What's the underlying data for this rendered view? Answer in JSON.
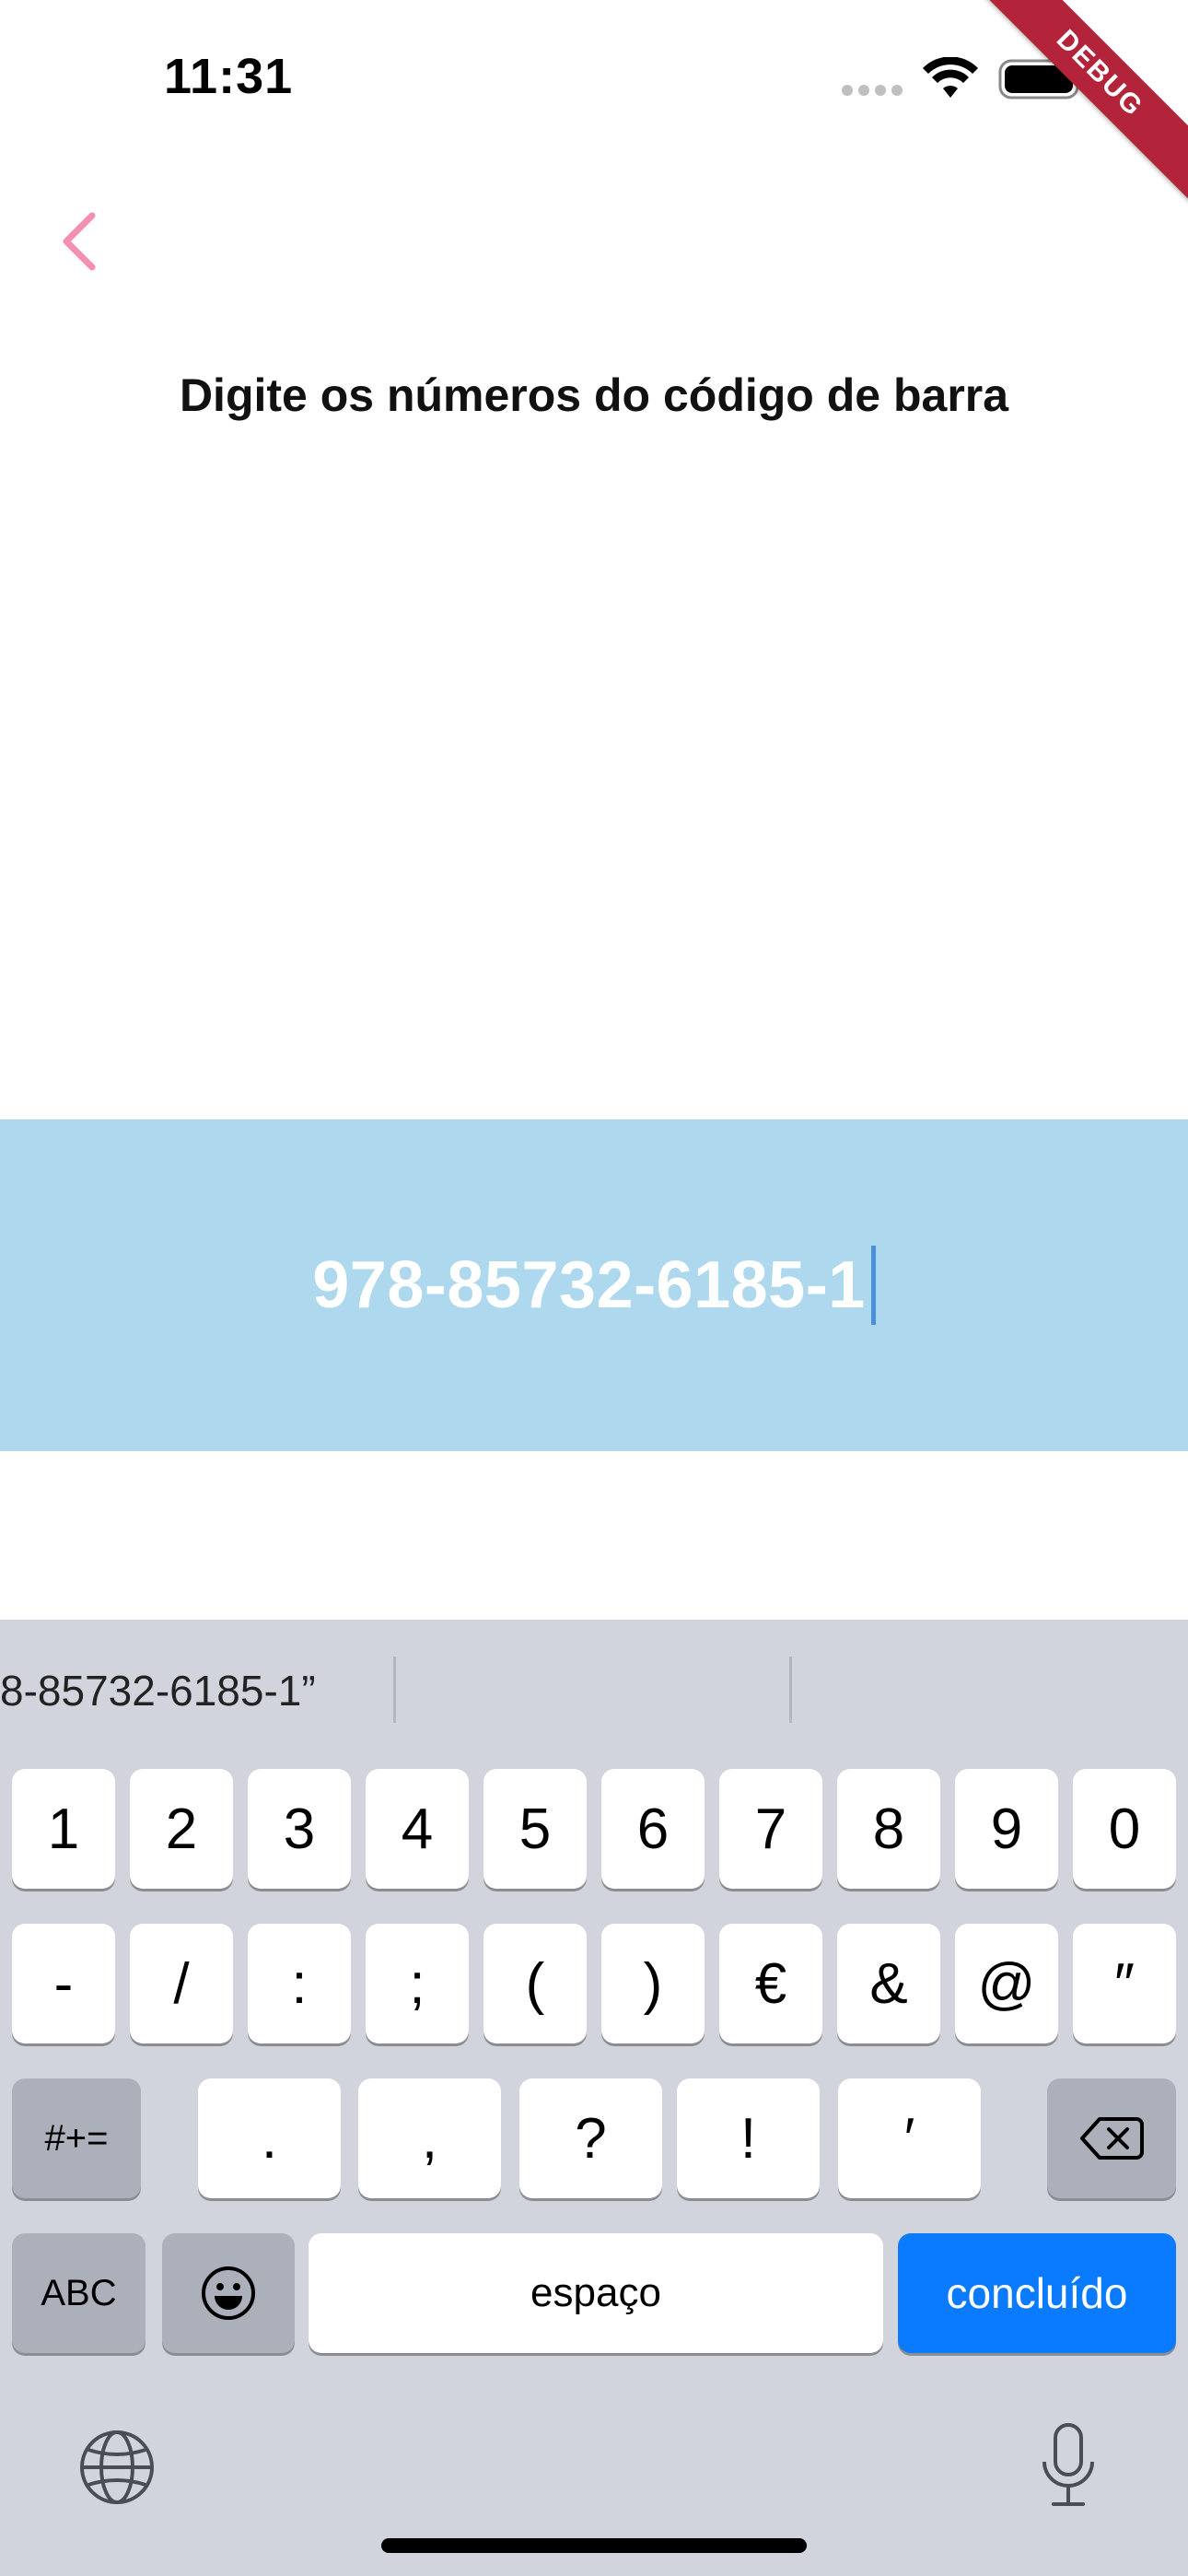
{
  "status_bar": {
    "time": "11:31"
  },
  "debug_banner": "DEBUG",
  "page": {
    "title": "Digite os números do código de barra"
  },
  "barcode_input": {
    "value": "978-85732-6185-1"
  },
  "keyboard": {
    "suggestion": "8-85732-6185-1”",
    "row1": [
      "1",
      "2",
      "3",
      "4",
      "5",
      "6",
      "7",
      "8",
      "9",
      "0"
    ],
    "row2": [
      "-",
      "/",
      ":",
      ";",
      "(",
      ")",
      "€",
      "&",
      "@",
      "″"
    ],
    "row3": {
      "switch": "#+=",
      "keys": [
        ".",
        ",",
        "?",
        "!",
        "′"
      ]
    },
    "row4": {
      "abc": "ABC",
      "space": "espaço",
      "done": "concluído"
    }
  },
  "colors": {
    "accent_back": "#f48fb1",
    "band": "#add8ee",
    "done_key": "#0a7bff",
    "debug": "#b3243a"
  }
}
